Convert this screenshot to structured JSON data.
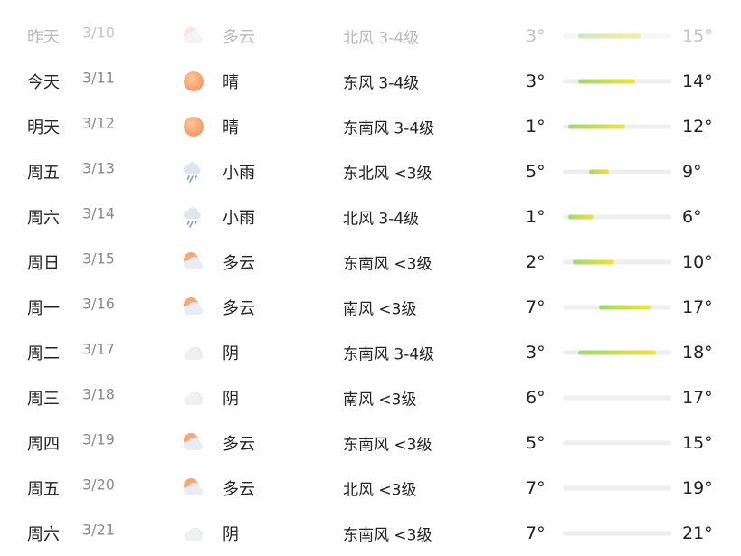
{
  "scale": {
    "min_temp": 0,
    "max_temp": 21
  },
  "rows": [
    {
      "day": "昨天",
      "date": "3/10",
      "icon": "cloudy-icon",
      "condition": "多云",
      "wind": "北风 3-4级",
      "low": "3°",
      "high": "15°",
      "low_value": 3,
      "high_value": 15,
      "range_visible": true,
      "past": true
    },
    {
      "day": "今天",
      "date": "3/11",
      "icon": "sunny-icon",
      "condition": "晴",
      "wind": "东风 3-4级",
      "low": "3°",
      "high": "14°",
      "low_value": 3,
      "high_value": 14,
      "range_visible": true,
      "past": false
    },
    {
      "day": "明天",
      "date": "3/12",
      "icon": "sunny-icon",
      "condition": "晴",
      "wind": "东南风 3-4级",
      "low": "1°",
      "high": "12°",
      "low_value": 1,
      "high_value": 12,
      "range_visible": true,
      "past": false
    },
    {
      "day": "周五",
      "date": "3/13",
      "icon": "light-rain-icon",
      "condition": "小雨",
      "wind": "东北风 <3级",
      "low": "5°",
      "high": "9°",
      "low_value": 5,
      "high_value": 9,
      "range_visible": true,
      "past": false
    },
    {
      "day": "周六",
      "date": "3/14",
      "icon": "light-rain-icon",
      "condition": "小雨",
      "wind": "北风 3-4级",
      "low": "1°",
      "high": "6°",
      "low_value": 1,
      "high_value": 6,
      "range_visible": true,
      "past": false
    },
    {
      "day": "周日",
      "date": "3/15",
      "icon": "partly-cloudy-icon",
      "condition": "多云",
      "wind": "东南风 <3级",
      "low": "2°",
      "high": "10°",
      "low_value": 2,
      "high_value": 10,
      "range_visible": true,
      "past": false
    },
    {
      "day": "周一",
      "date": "3/16",
      "icon": "partly-cloudy-icon",
      "condition": "多云",
      "wind": "南风 <3级",
      "low": "7°",
      "high": "17°",
      "low_value": 7,
      "high_value": 17,
      "range_visible": true,
      "past": false
    },
    {
      "day": "周二",
      "date": "3/17",
      "icon": "overcast-icon",
      "condition": "阴",
      "wind": "东南风 3-4级",
      "low": "3°",
      "high": "18°",
      "low_value": 3,
      "high_value": 18,
      "range_visible": true,
      "past": false
    },
    {
      "day": "周三",
      "date": "3/18",
      "icon": "overcast-icon",
      "condition": "阴",
      "wind": "南风 <3级",
      "low": "6°",
      "high": "17°",
      "low_value": 6,
      "high_value": 17,
      "range_visible": false,
      "past": false
    },
    {
      "day": "周四",
      "date": "3/19",
      "icon": "partly-cloudy-icon",
      "condition": "多云",
      "wind": "东南风 <3级",
      "low": "5°",
      "high": "15°",
      "low_value": 5,
      "high_value": 15,
      "range_visible": false,
      "past": false
    },
    {
      "day": "周五",
      "date": "3/20",
      "icon": "partly-cloudy-icon",
      "condition": "多云",
      "wind": "北风 <3级",
      "low": "7°",
      "high": "19°",
      "low_value": 7,
      "high_value": 19,
      "range_visible": false,
      "past": false
    },
    {
      "day": "周六",
      "date": "3/21",
      "icon": "overcast-icon",
      "condition": "阴",
      "wind": "东南风 <3级",
      "low": "7°",
      "high": "21°",
      "low_value": 7,
      "high_value": 21,
      "range_visible": false,
      "past": false
    }
  ]
}
